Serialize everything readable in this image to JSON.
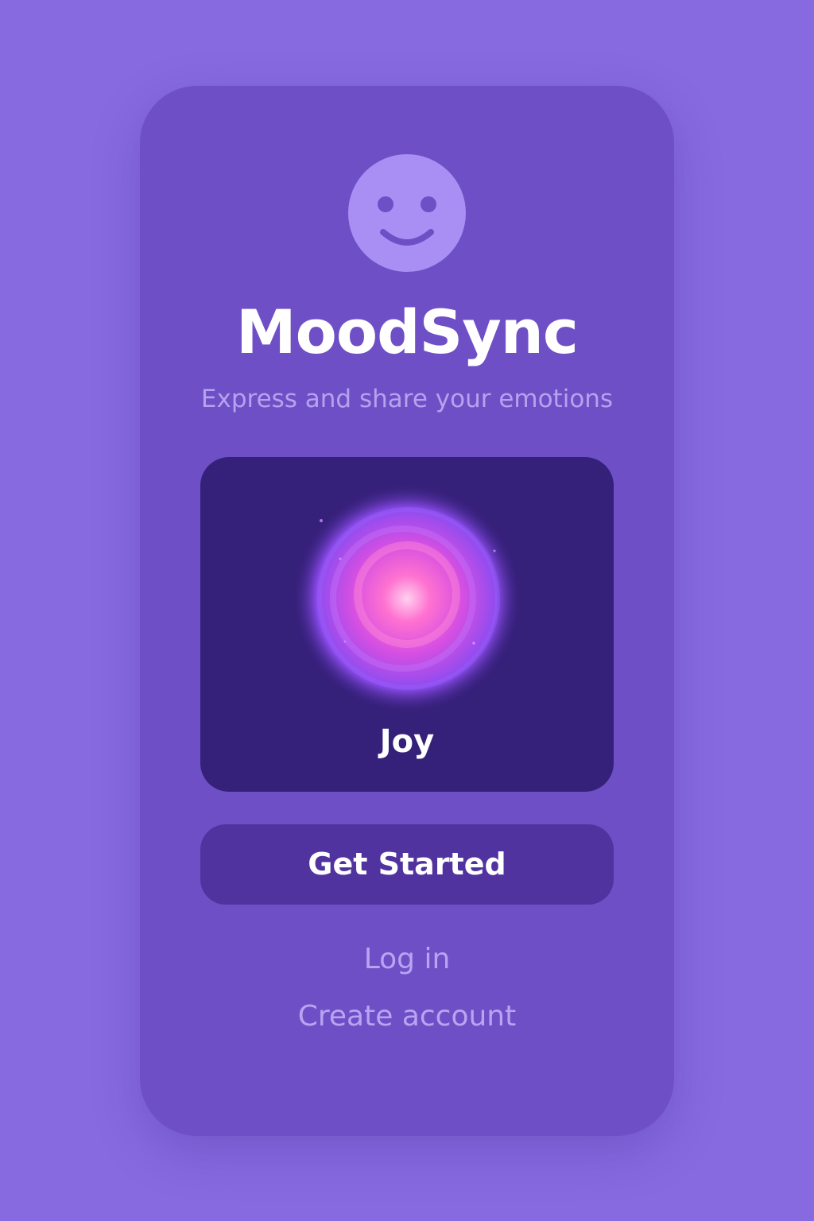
{
  "app": {
    "title": "MoodSync",
    "tagline": "Express and share your emotions"
  },
  "mood_card": {
    "label": "Joy",
    "icon": "joy-orb-icon"
  },
  "actions": {
    "primary_label": "Get Started",
    "login_label": "Log in",
    "create_label": "Create account"
  },
  "logo_icon": "smiley-face-icon",
  "colors": {
    "background": "#876ae0",
    "phone": "#6e4fc6",
    "logo": "#a98ff4",
    "card": "#35207a",
    "button": "#51339f",
    "orb_core": "#ff5fc8",
    "orb_outer": "#8f4cf0",
    "text_primary": "#ffffff",
    "text_muted": "#baa4f2"
  }
}
